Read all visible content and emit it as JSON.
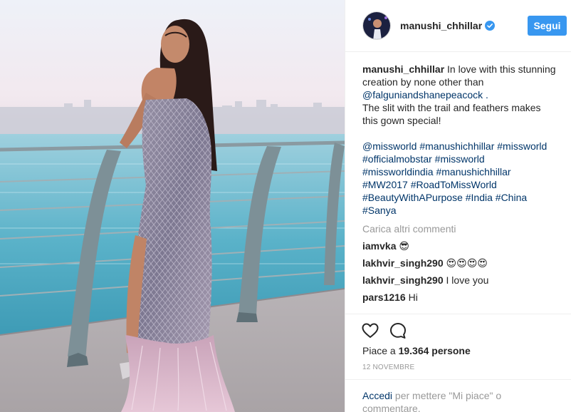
{
  "post": {
    "username": "manushi_chhillar",
    "follow_label": "Segui",
    "caption_lines": [
      "In love with this stunning",
      "creation by none other than",
      "@falguniandshanepeacock .",
      "The slit with the trail and feathers makes",
      "this gown special!"
    ],
    "hashtag_lines": [
      "@missworld #manushichhillar #missworld",
      "#officialmobstar #missworld",
      "#missworldindia #manushichhillar",
      "#MW2017 #RoadToMissWorld",
      "#BeautyWithAPurpose #India #China",
      "#Sanya"
    ],
    "load_more": "Carica altri commenti",
    "comments": [
      {
        "user": "iamvka",
        "text": "😎"
      },
      {
        "user": "lakhvir_singh290",
        "text": "😍😍😍😍"
      },
      {
        "user": "lakhvir_singh290",
        "text": "I love you"
      },
      {
        "user": "pars1216",
        "text": "Hi"
      }
    ],
    "likes_prefix": "Piace a",
    "likes_count": "19.364 persone",
    "date": "12 NOVEMBRE",
    "login_link": "Accedi",
    "login_text": "per mettere \"Mi piace\" o commentare."
  },
  "icons": {
    "verified": "verified-badge-icon",
    "like": "heart-icon",
    "comment": "comment-icon"
  },
  "colors": {
    "accent": "#3897f0",
    "link": "#003569",
    "muted": "#999999",
    "text": "#262626"
  }
}
